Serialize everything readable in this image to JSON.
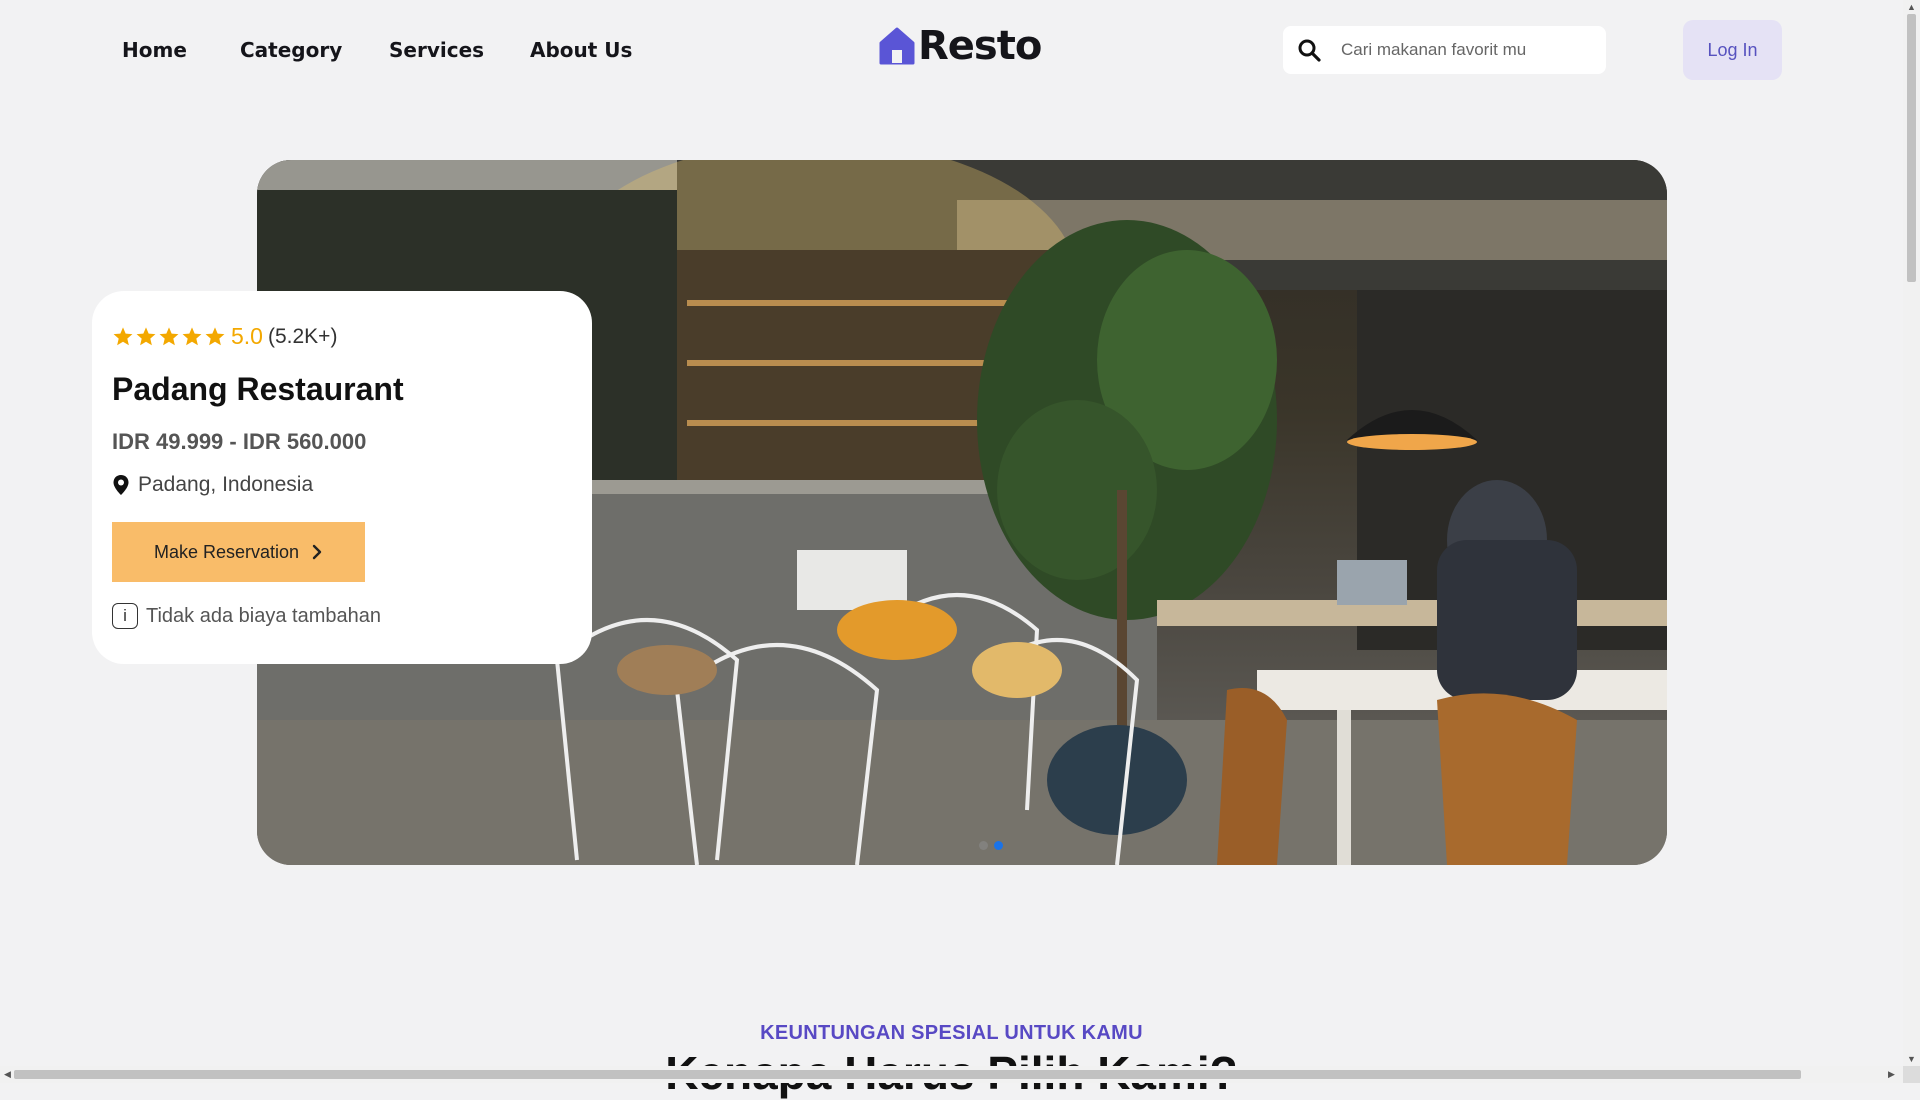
{
  "nav": {
    "links": [
      "Home",
      "Category",
      "Services",
      "About Us"
    ],
    "logo_text": "Resto",
    "search_placeholder": "Cari makanan favorit mu",
    "login_label": "Log In"
  },
  "hero": {
    "slides_total": 2,
    "active_slide": 2
  },
  "card": {
    "rating_stars": 5,
    "rating_score": "5.0",
    "rating_count": "(5.2K+)",
    "title": "Padang Restaurant",
    "price": "IDR 49.999 - IDR 560.000",
    "location": "Padang, Indonesia",
    "cta_label": "Make Reservation",
    "note": "Tidak ada biaya tambahan",
    "info_icon_glyph": "i"
  },
  "section": {
    "eyebrow": "KEUNTUNGAN SPESIAL UNTUK KAMU",
    "title": "Kenapa Harus Pilih Kami?"
  },
  "colors": {
    "accent": "#5849c4",
    "star": "#f3a800",
    "cta": "#f9bc69",
    "login_bg": "#e5e2f5",
    "active_dot": "#1a73e8"
  },
  "icons": {
    "search": "search-icon",
    "logo": "house-icon",
    "location": "location-pin-icon",
    "chevron": "chevron-right-icon",
    "info": "info-icon",
    "star": "star-icon"
  }
}
